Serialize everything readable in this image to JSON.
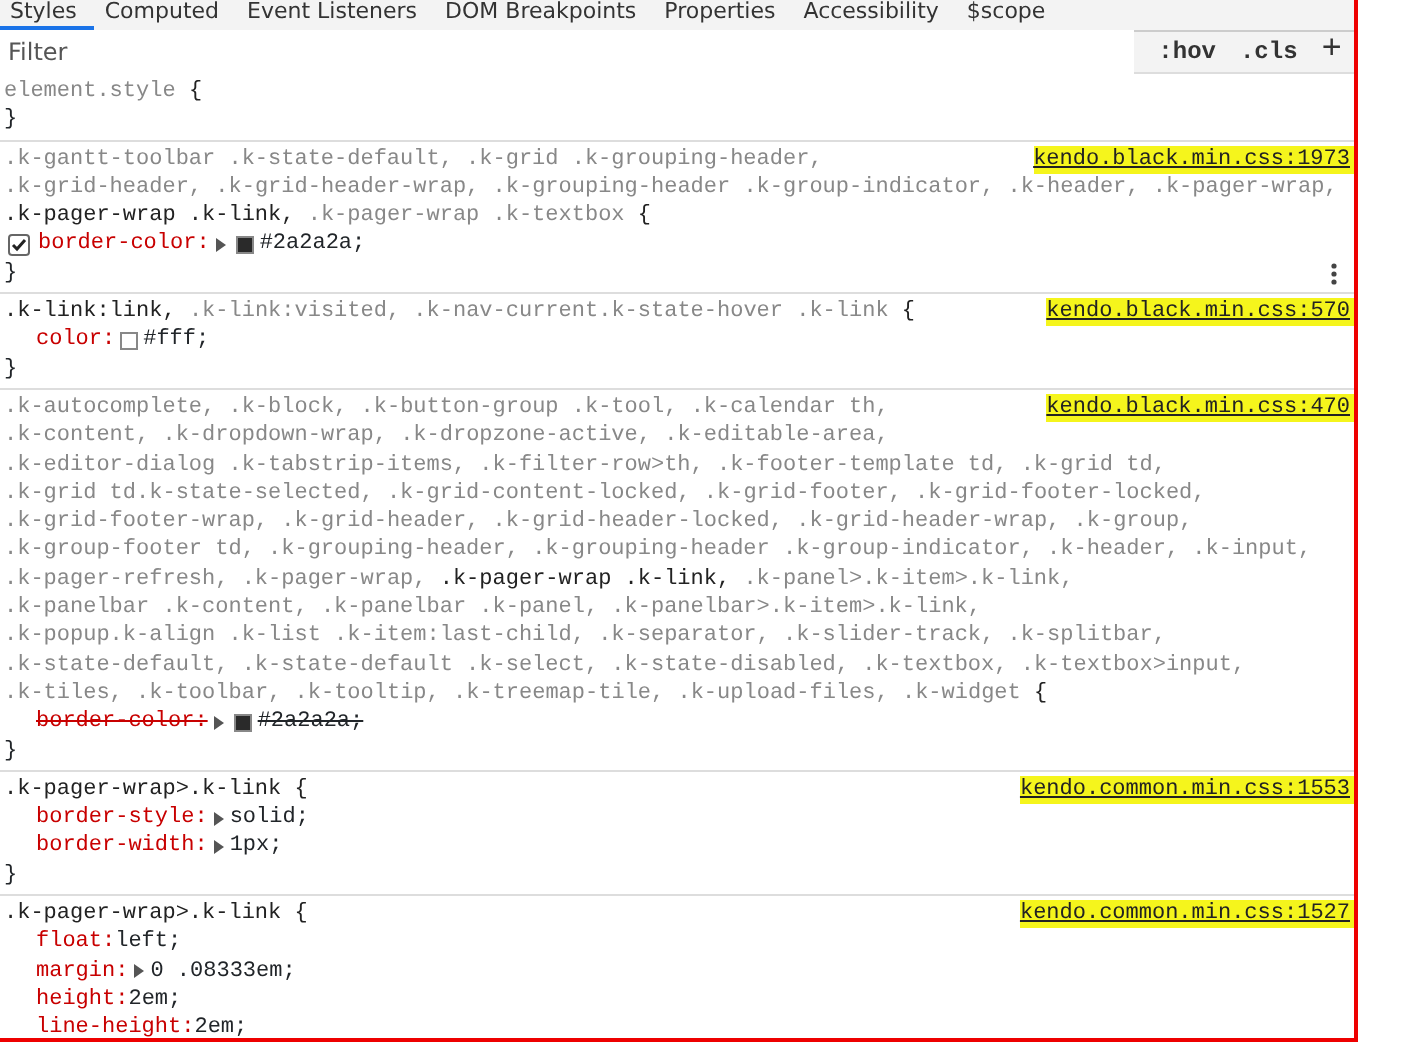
{
  "tabs": [
    {
      "label": "Styles",
      "selected": true
    },
    {
      "label": "Computed",
      "selected": false
    },
    {
      "label": "Event Listeners",
      "selected": false
    },
    {
      "label": "DOM Breakpoints",
      "selected": false
    },
    {
      "label": "Properties",
      "selected": false
    },
    {
      "label": "Accessibility",
      "selected": false
    },
    {
      "label": "$scope",
      "selected": false
    }
  ],
  "filter": {
    "placeholder": "Filter"
  },
  "toolbar": [
    {
      "kind": "text",
      "label": ":hov"
    },
    {
      "kind": "text",
      "label": ".cls"
    },
    {
      "kind": "add",
      "label": "+"
    }
  ],
  "rules": [
    {
      "selector": [
        {
          "text": "element.style",
          "matched": false
        }
      ],
      "open": "{",
      "close": "}",
      "hovered": false
    },
    {
      "selector": [
        {
          "text": ".k-gantt-toolbar .k-state-default,",
          "matched": false
        },
        {
          "text": ".k-grid .k-grouping-header,",
          "matched": false
        },
        {
          "text": ".k-grid-header,",
          "matched": false
        },
        {
          "text": ".k-grid-header-wrap,",
          "matched": false
        },
        {
          "text": ".k-grouping-header .k-group-indicator,",
          "matched": false
        },
        {
          "text": ".k-header,",
          "matched": false
        },
        {
          "text": ".k-pager-wrap,",
          "matched": false
        },
        {
          "text": ".k-pager-wrap .k-link,",
          "matched": true
        },
        {
          "text": ".k-pager-wrap .k-textbox",
          "matched": false
        }
      ],
      "open": "{",
      "source": "kendo.black.min.css:1973",
      "highlighted": true,
      "close": "}",
      "hovered": true,
      "declarations": [
        {
          "name": "border-color:",
          "value": "#2a2a2a;",
          "color": "#2a2a2a",
          "expandable": true,
          "overridden": false,
          "checked": true
        }
      ]
    },
    {
      "selector": [
        {
          "text": ".k-link:link,",
          "matched": true
        },
        {
          "text": ".k-link:visited,",
          "matched": false
        },
        {
          "text": ".k-nav-current.k-state-hover .k-link",
          "matched": false
        }
      ],
      "open": "{",
      "source": "kendo.black.min.css:570",
      "highlighted": true,
      "close": "}",
      "hovered": false,
      "declarations": [
        {
          "name": "color:",
          "value": "#fff;",
          "color": "#ffffff",
          "expandable": false,
          "overridden": false,
          "checked": true
        }
      ]
    },
    {
      "selector": [
        {
          "text": ".k-autocomplete,",
          "matched": false
        },
        {
          "text": ".k-block,",
          "matched": false
        },
        {
          "text": ".k-button-group .k-tool,",
          "matched": false
        },
        {
          "text": ".k-calendar th,",
          "matched": false
        },
        {
          "text": ".k-content,",
          "matched": false
        },
        {
          "text": ".k-dropdown-wrap,",
          "matched": false
        },
        {
          "text": ".k-dropzone-active,",
          "matched": false
        },
        {
          "text": ".k-editable-area,",
          "matched": false
        },
        {
          "text": ".k-editor-dialog .k-tabstrip-items,",
          "matched": false
        },
        {
          "text": ".k-filter-row>th,",
          "matched": false
        },
        {
          "text": ".k-footer-template td,",
          "matched": false
        },
        {
          "text": ".k-grid td,",
          "matched": false
        },
        {
          "text": ".k-grid td.k-state-selected,",
          "matched": false
        },
        {
          "text": ".k-grid-content-locked,",
          "matched": false
        },
        {
          "text": ".k-grid-footer,",
          "matched": false
        },
        {
          "text": ".k-grid-footer-locked,",
          "matched": false
        },
        {
          "text": ".k-grid-footer-wrap,",
          "matched": false
        },
        {
          "text": ".k-grid-header,",
          "matched": false
        },
        {
          "text": ".k-grid-header-locked,",
          "matched": false
        },
        {
          "text": ".k-grid-header-wrap,",
          "matched": false
        },
        {
          "text": ".k-group,",
          "matched": false
        },
        {
          "text": ".k-group-footer td,",
          "matched": false
        },
        {
          "text": ".k-grouping-header,",
          "matched": false
        },
        {
          "text": ".k-grouping-header .k-group-indicator,",
          "matched": false
        },
        {
          "text": ".k-header,",
          "matched": false
        },
        {
          "text": ".k-input,",
          "matched": false
        },
        {
          "text": ".k-pager-refresh,",
          "matched": false
        },
        {
          "text": ".k-pager-wrap,",
          "matched": false
        },
        {
          "text": ".k-pager-wrap .k-link,",
          "matched": true
        },
        {
          "text": ".k-panel>.k-item>.k-link,",
          "matched": false
        },
        {
          "text": ".k-panelbar .k-content,",
          "matched": false
        },
        {
          "text": ".k-panelbar .k-panel,",
          "matched": false
        },
        {
          "text": ".k-panelbar>.k-item>.k-link,",
          "matched": false
        },
        {
          "text": ".k-popup.k-align .k-list .k-item:last-child,",
          "matched": false
        },
        {
          "text": ".k-separator,",
          "matched": false
        },
        {
          "text": ".k-slider-track,",
          "matched": false
        },
        {
          "text": ".k-splitbar,",
          "matched": false
        },
        {
          "text": ".k-state-default,",
          "matched": false
        },
        {
          "text": ".k-state-default .k-select,",
          "matched": false
        },
        {
          "text": ".k-state-disabled,",
          "matched": false
        },
        {
          "text": ".k-textbox,",
          "matched": false
        },
        {
          "text": ".k-textbox>input,",
          "matched": false
        },
        {
          "text": ".k-tiles,",
          "matched": false
        },
        {
          "text": ".k-toolbar,",
          "matched": false
        },
        {
          "text": ".k-tooltip,",
          "matched": false
        },
        {
          "text": ".k-treemap-tile,",
          "matched": false
        },
        {
          "text": ".k-upload-files,",
          "matched": false
        },
        {
          "text": ".k-widget",
          "matched": false
        }
      ],
      "open": "{",
      "source": "kendo.black.min.css:470",
      "highlighted": true,
      "close": "}",
      "hovered": false,
      "declarations": [
        {
          "name": "border-color:",
          "value": "#2a2a2a;",
          "color": "#2a2a2a",
          "expandable": true,
          "overridden": true,
          "checked": true
        }
      ]
    },
    {
      "selector": [
        {
          "text": ".k-pager-wrap>.k-link",
          "matched": true
        }
      ],
      "open": "{",
      "source": "kendo.common.min.css:1553",
      "highlighted": true,
      "close": "}",
      "hovered": false,
      "declarations": [
        {
          "name": "border-style:",
          "value": "solid;",
          "expandable": true,
          "overridden": false,
          "checked": true
        },
        {
          "name": "border-width:",
          "value": "1px;",
          "expandable": true,
          "overridden": false,
          "checked": true
        }
      ]
    },
    {
      "selector": [
        {
          "text": ".k-pager-wrap>.k-link",
          "matched": true
        }
      ],
      "open": "{",
      "source": "kendo.common.min.css:1527",
      "highlighted": true,
      "hovered": false,
      "declarations": [
        {
          "name": "float:",
          "value": "left;",
          "expandable": false,
          "overridden": false,
          "checked": true
        },
        {
          "name": "margin:",
          "value": "0 .08333em;",
          "expandable": true,
          "overridden": false,
          "checked": true
        },
        {
          "name": "height:",
          "value": "2em;",
          "expandable": false,
          "overridden": false,
          "checked": true
        },
        {
          "name": "line-height:",
          "value": "2em;",
          "expandable": false,
          "overridden": false,
          "checked": true
        }
      ]
    }
  ]
}
